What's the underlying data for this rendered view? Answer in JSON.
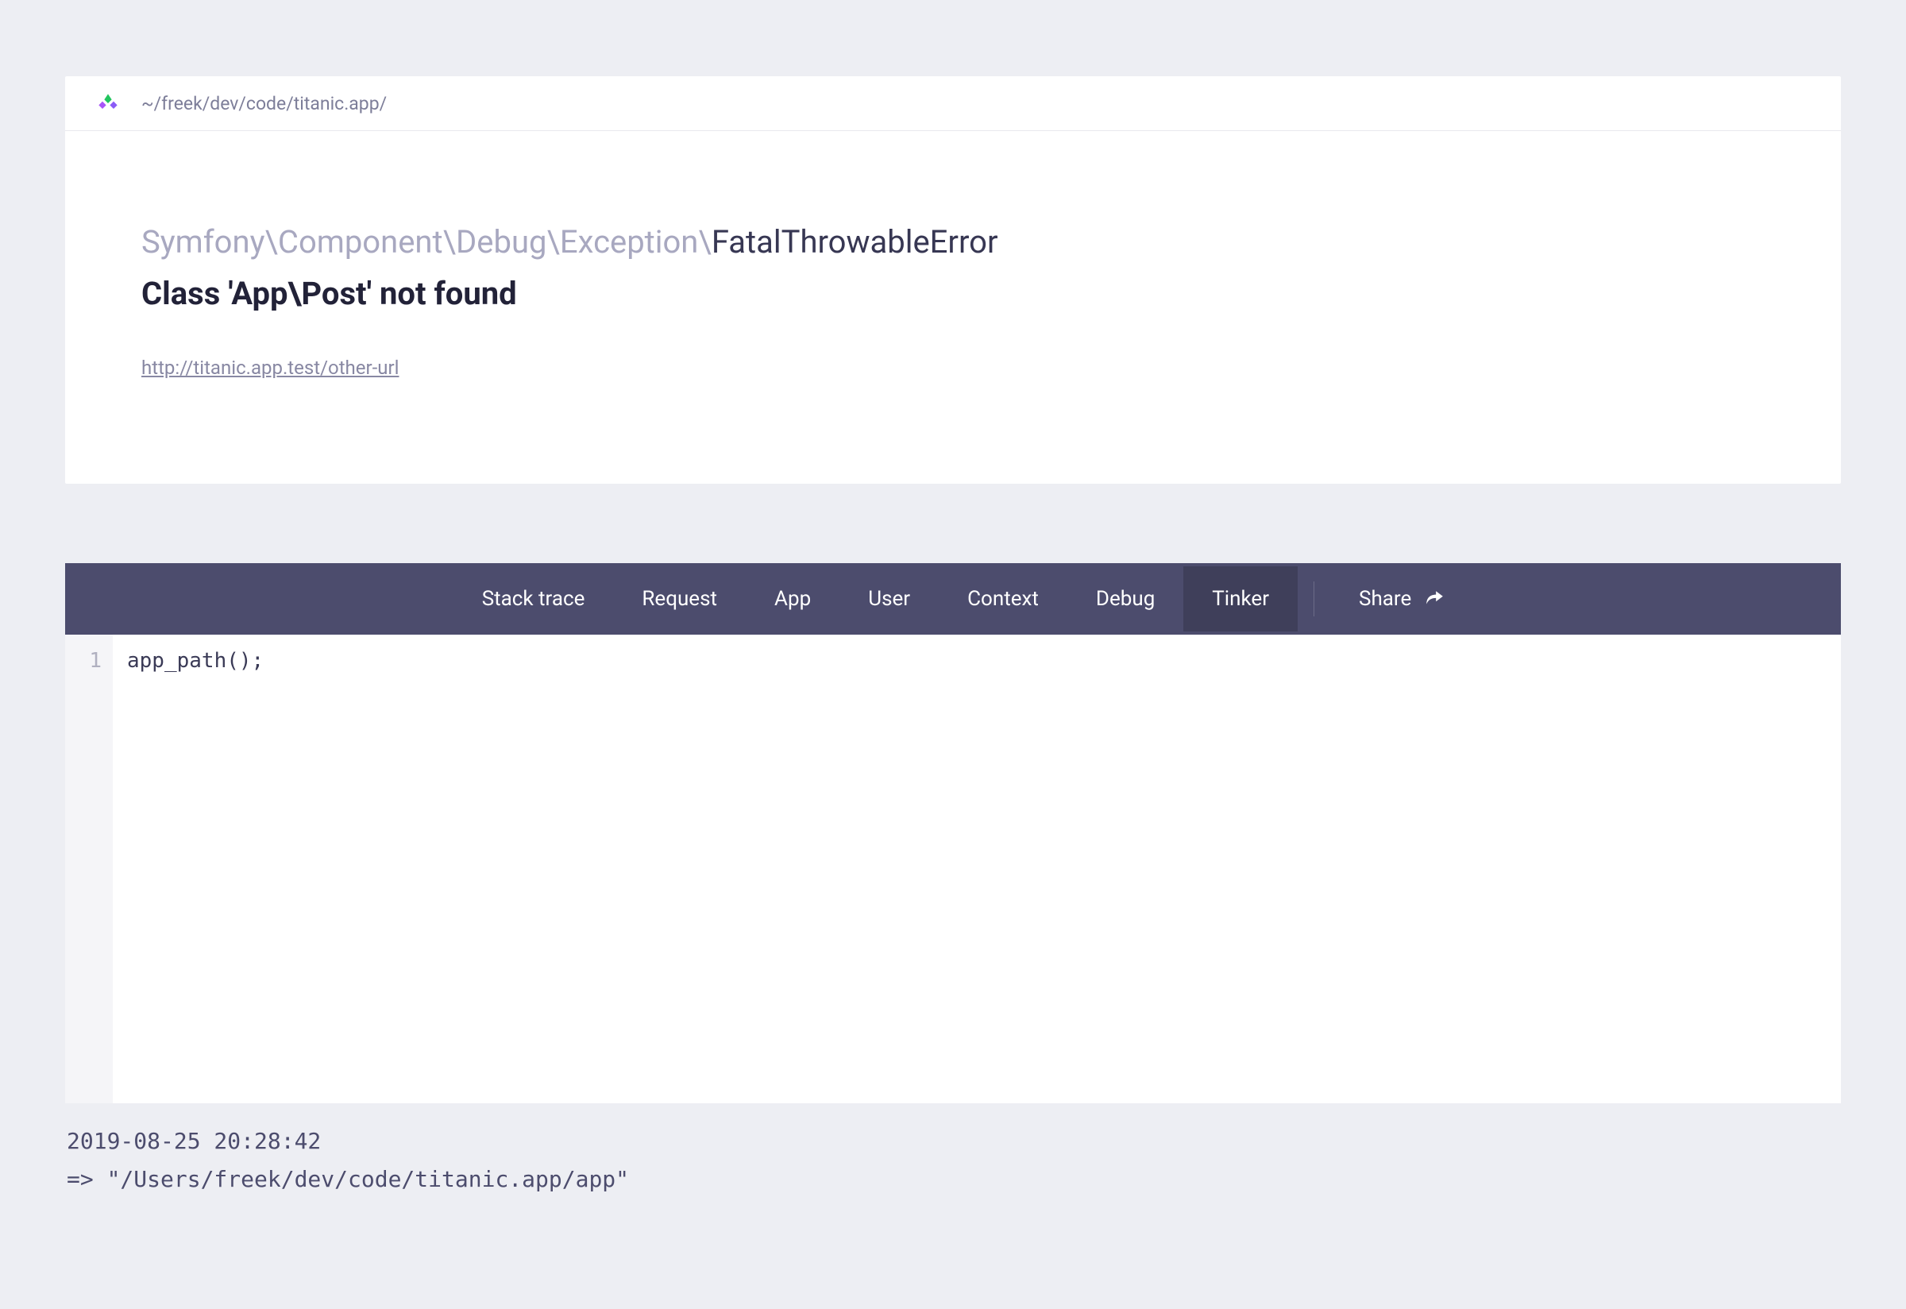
{
  "header": {
    "breadcrumb": "~/freek/dev/code/titanic.app/"
  },
  "exception": {
    "namespace": "Symfony\\Component\\Debug\\Exception\\",
    "class": "FatalThrowableError",
    "message": "Class 'App\\Post' not found",
    "url": "http://titanic.app.test/other-url"
  },
  "nav": {
    "tabs": [
      {
        "label": "Stack trace",
        "active": false
      },
      {
        "label": "Request",
        "active": false
      },
      {
        "label": "App",
        "active": false
      },
      {
        "label": "User",
        "active": false
      },
      {
        "label": "Context",
        "active": false
      },
      {
        "label": "Debug",
        "active": false
      },
      {
        "label": "Tinker",
        "active": true
      }
    ],
    "share_label": "Share"
  },
  "editor": {
    "line_number": "1",
    "code": "app_path();"
  },
  "output": {
    "timestamp": "2019-08-25 20:28:42",
    "result": "=> \"/Users/freek/dev/code/titanic.app/app\""
  }
}
